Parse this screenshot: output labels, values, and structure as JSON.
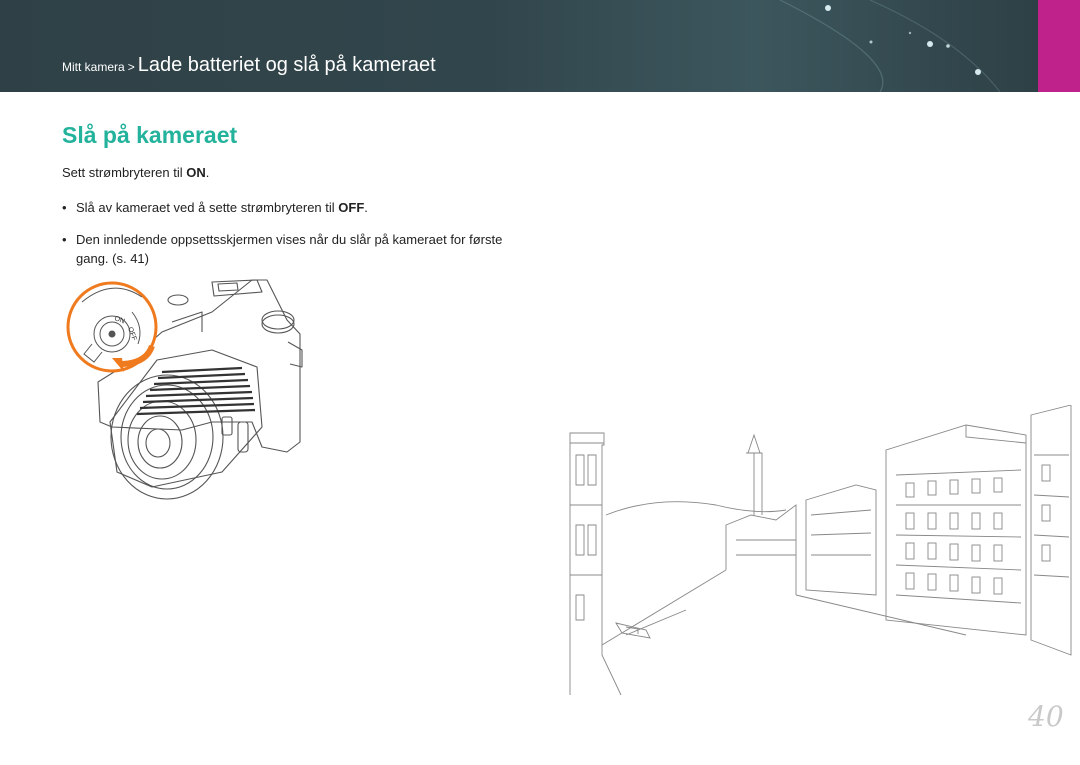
{
  "header": {
    "breadcrumb_parent": "Mitt kamera",
    "breadcrumb_separator": ">",
    "breadcrumb_current": "Lade batteriet og slå på kameraet",
    "accent_color": "#c0228c",
    "bar_color": "#31464c"
  },
  "section": {
    "title": "Slå på kameraet",
    "title_color": "#23b29b",
    "intro_prefix": "Sett strømbryteren til ",
    "intro_bold": "ON",
    "intro_suffix": ".",
    "bullets": [
      {
        "prefix": "Slå av kameraet ved å sette strømbryteren til ",
        "bold": "OFF",
        "suffix": "."
      },
      {
        "text": "Den innledende oppsettsskjermen vises når du slår på kameraet for første gang. (s. 41)"
      }
    ]
  },
  "illustrations": {
    "camera_switch_on": "ON",
    "camera_switch_off": "OFF",
    "callout_color": "#f07a1e"
  },
  "page": {
    "number": "40"
  }
}
